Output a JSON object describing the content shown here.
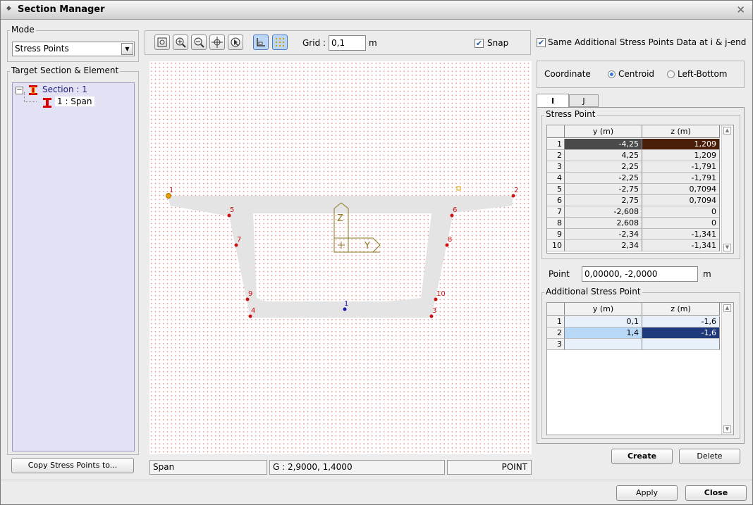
{
  "window": {
    "title": "Section Manager"
  },
  "mode": {
    "label": "Mode",
    "value": "Stress Points"
  },
  "target": {
    "label": "Target Section & Element",
    "section": "Section : 1",
    "element": "1 : Span",
    "expander": "−"
  },
  "copy_button": "Copy Stress Points to...",
  "toolbar": {
    "grid_label": "Grid :",
    "grid_value": "0,1",
    "grid_unit": "m",
    "snap_label": "Snap"
  },
  "canvas": {
    "point_labels": [
      "1",
      "2",
      "3",
      "4",
      "5",
      "6",
      "7",
      "8",
      "9",
      "10"
    ],
    "additional_labels": [
      "1"
    ],
    "axis_z": "Z",
    "axis_y": "Y"
  },
  "status": {
    "name": "Span",
    "coords": "G : 2,9000, 1,4000",
    "mode": "POINT"
  },
  "same_data": {
    "label": "Same Additional Stress Points Data at i & j-end"
  },
  "coordinate": {
    "label": "Coordinate",
    "opt1": "Centroid",
    "opt2": "Left-Bottom"
  },
  "tabs": {
    "i": "I",
    "j": "J"
  },
  "stress_point": {
    "label": "Stress Point",
    "headers": [
      "y (m)",
      "z (m)"
    ],
    "rows": [
      {
        "n": "1",
        "y": "-4,25",
        "z": "1,209"
      },
      {
        "n": "2",
        "y": "4,25",
        "z": "1,209"
      },
      {
        "n": "3",
        "y": "2,25",
        "z": "-1,791"
      },
      {
        "n": "4",
        "y": "-2,25",
        "z": "-1,791"
      },
      {
        "n": "5",
        "y": "-2,75",
        "z": "0,7094"
      },
      {
        "n": "6",
        "y": "2,75",
        "z": "0,7094"
      },
      {
        "n": "7",
        "y": "-2,608",
        "z": "0"
      },
      {
        "n": "8",
        "y": "2,608",
        "z": "0"
      },
      {
        "n": "9",
        "y": "-2,34",
        "z": "-1,341"
      },
      {
        "n": "10",
        "y": "2,34",
        "z": "-1,341"
      }
    ]
  },
  "point": {
    "label": "Point",
    "value": "0,00000, -2,0000",
    "unit": "m"
  },
  "additional": {
    "label": "Additional Stress Point",
    "headers": [
      "y (m)",
      "z (m)"
    ],
    "rows": [
      {
        "n": "1",
        "y": "0,1",
        "z": "-1,6"
      },
      {
        "n": "2",
        "y": "1,4",
        "z": "-1,6"
      },
      {
        "n": "3",
        "y": "",
        "z": ""
      }
    ]
  },
  "buttons": {
    "create": "Create",
    "delete": "Delete",
    "apply": "Apply",
    "close": "Close"
  },
  "colors": {
    "point": "#cc1111",
    "selected_point": "#e8a000",
    "additional_point": "#1a1aa8",
    "axis": "#8a7a20",
    "selected_row": "#1e3a7a"
  }
}
